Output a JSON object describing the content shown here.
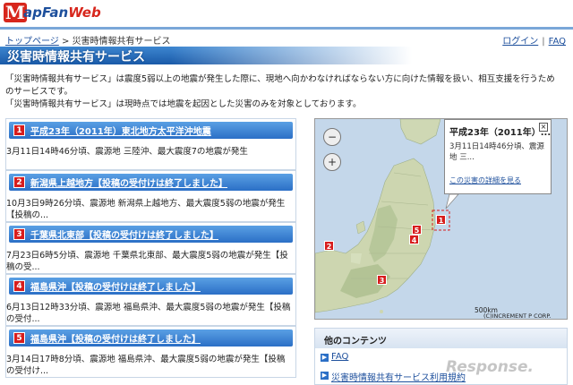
{
  "header": {
    "logo_letter": "M",
    "logo_text": "apFan",
    "logo_text2": "Web",
    "breadcrumb_home": "トップページ",
    "breadcrumb_sep": " > ",
    "breadcrumb_current": "災害時情報共有サービス",
    "login": "ログイン",
    "faq": "FAQ",
    "links_sep": "|"
  },
  "page": {
    "title": "災害時情報共有サービス",
    "intro_line1": "「災害時情報共有サービス」は震度5弱以上の地震が発生した際に、現地へ向かわなければならない方に向けた情報を扱い、相互支援を行うためのサービスです。",
    "intro_line2": "「災害時情報共有サービス」は現時点では地震を起因とした災害のみを対象としております。"
  },
  "disasters": [
    {
      "num": "1",
      "title": "平成23年（2011年）東北地方太平洋沖地震",
      "desc": "3月11日14時46分頃、震源地 三陸沖、最大震度7の地震が発生"
    },
    {
      "num": "2",
      "title": "新潟県上越地方【投稿の受付けは終了しました】",
      "desc": "10月3日9時26分頃、震源地 新潟県上越地方、最大震度5弱の地震が発生【投稿の..."
    },
    {
      "num": "3",
      "title": "千葉県北東部【投稿の受付けは終了しました】",
      "desc": "7月23日6時5分頃、震源地 千葉県北東部、最大震度5弱の地震が発生【投稿の受..."
    },
    {
      "num": "4",
      "title": "福島県沖【投稿の受付けは終了しました】",
      "desc": "6月13日12時33分頃、震源地 福島県沖、最大震度5弱の地震が発生【投稿の受付..."
    },
    {
      "num": "5",
      "title": "福島県沖【投稿の受付けは終了しました】",
      "desc": "3月14日17時8分頃、震源地 福島県沖、最大震度5弱の地震が発生【投稿の受付け..."
    }
  ],
  "map": {
    "zoom_out": "−",
    "zoom_in": "+",
    "popup_title": "平成23年（2011年）...",
    "popup_body": "3月11日14時46分頃、震源地 三...",
    "popup_link": "この災害の詳細を見る",
    "popup_close": "×",
    "scale": "500km",
    "copyright": "(C)INCREMENT P CORP.",
    "markers": [
      {
        "num": "1"
      },
      {
        "num": "2"
      },
      {
        "num": "3"
      },
      {
        "num": "4"
      },
      {
        "num": "5"
      }
    ]
  },
  "other": {
    "heading": "他のコンテンツ",
    "items": [
      {
        "label": "FAQ"
      },
      {
        "label": "災害時情報共有サービス利用規約"
      }
    ]
  },
  "watermark": "Response.",
  "colors": {
    "accent": "#1d4f9c",
    "marker": "#d71d1d",
    "bar": "#2b6fc6"
  }
}
